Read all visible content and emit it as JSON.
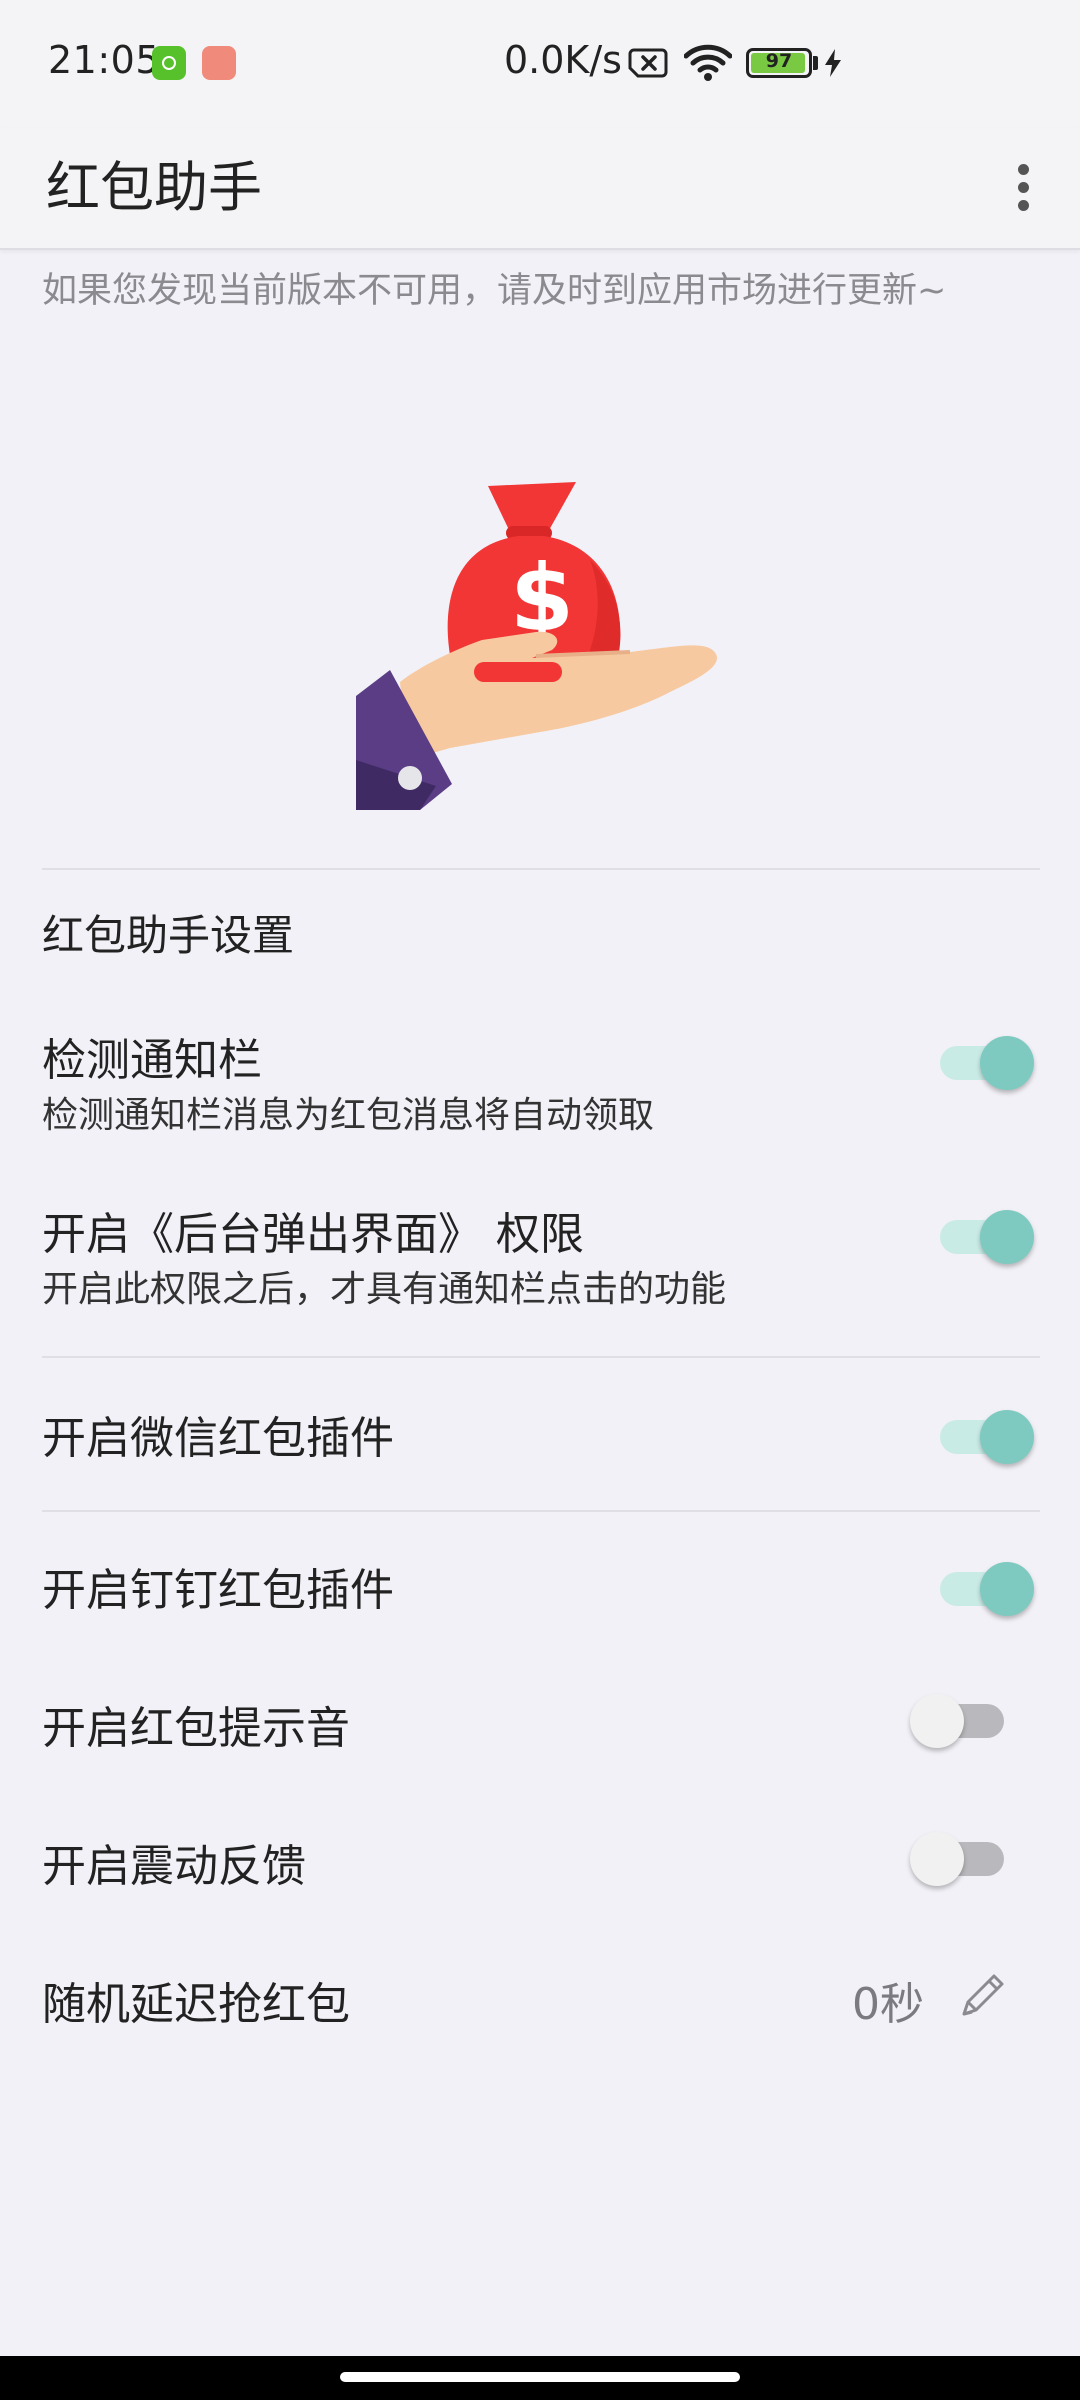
{
  "status_bar": {
    "time": "21:05",
    "net_speed": "0.0K/s",
    "battery_level": "97",
    "battery_fraction": 0.97,
    "icons": [
      "app-notification-icon",
      "app-notification-icon",
      "sim-disabled-icon",
      "wifi-icon",
      "battery-icon",
      "charging-icon"
    ]
  },
  "app_bar": {
    "title": "红包助手",
    "menu_icon": "more-vert-icon"
  },
  "notice": "如果您发现当前版本不可用，请及时到应用市场进行更新~",
  "hero_icon": "money-bag-in-hand-icon",
  "colors": {
    "switch_on": "#7ecac0",
    "switch_on_track": "#c9ebe6",
    "switch_off_thumb": "#f1f1f1",
    "switch_off_track": "#b9b9bd",
    "bag": "#f23535"
  },
  "settings": {
    "section_title": "红包助手设置",
    "items": [
      {
        "title": "检测通知栏",
        "subtitle": "检测通知栏消息为红包消息将自动领取",
        "checked": true
      },
      {
        "title": "开启《后台弹出界面》 权限",
        "subtitle": "开启此权限之后，才具有通知栏点击的功能",
        "checked": true
      },
      {
        "title": "开启微信红包插件",
        "checked": true
      },
      {
        "title": "开启钉钉红包插件",
        "checked": true
      },
      {
        "title": "开启红包提示音",
        "checked": false
      },
      {
        "title": "开启震动反馈",
        "checked": false
      }
    ],
    "delay": {
      "title": "随机延迟抢红包",
      "value": "0秒",
      "icon": "edit-pencil-icon"
    }
  }
}
